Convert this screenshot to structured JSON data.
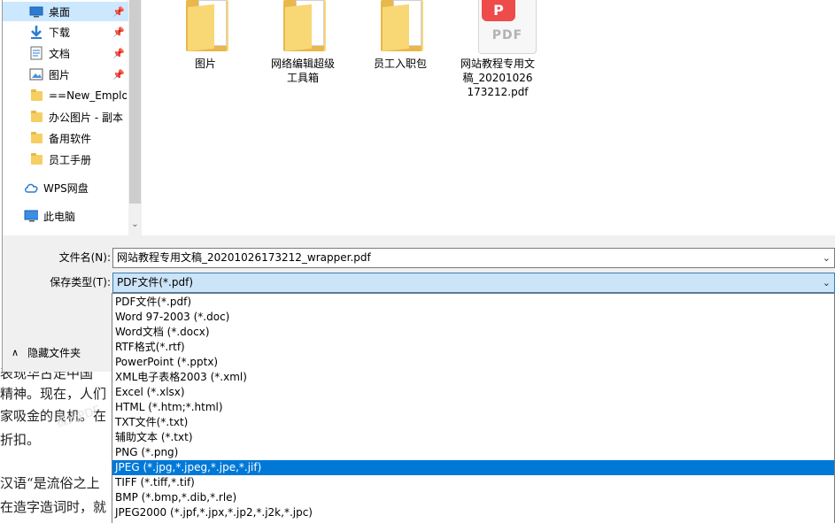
{
  "nav": {
    "items": [
      {
        "label": "桌面",
        "icon": "desktop-icon",
        "pinned": true,
        "selected": true
      },
      {
        "label": "下载",
        "icon": "download-icon",
        "pinned": true,
        "selected": false
      },
      {
        "label": "文档",
        "icon": "document-icon",
        "pinned": true,
        "selected": false
      },
      {
        "label": "图片",
        "icon": "picture-icon",
        "pinned": true,
        "selected": false
      },
      {
        "label": "==New_Emplo",
        "icon": "folder-icon",
        "pinned": false,
        "selected": false
      },
      {
        "label": "办公图片 - 副本",
        "icon": "folder-icon",
        "pinned": false,
        "selected": false
      },
      {
        "label": "备用软件",
        "icon": "folder-icon",
        "pinned": false,
        "selected": false
      },
      {
        "label": "员工手册",
        "icon": "folder-icon",
        "pinned": false,
        "selected": false
      }
    ],
    "wps_label": "WPS网盘",
    "pc_label": "此电脑"
  },
  "files": [
    {
      "name": "图片",
      "type": "folder"
    },
    {
      "name": "网络编辑超级工具箱",
      "type": "folder"
    },
    {
      "name": "员工入职包",
      "type": "folder"
    },
    {
      "name": "网站教程专用文稿_20201026173212.pdf",
      "type": "pdf",
      "badge_text": "PDF"
    }
  ],
  "form": {
    "filename_label": "文件名(N):",
    "filename_value": "网站教程专用文稿_20201026173212_wrapper.pdf",
    "type_label": "保存类型(T):",
    "type_value": "PDF文件(*.pdf)"
  },
  "hide_folders_label": "隐藏文件夹",
  "type_options": [
    "PDF文件(*.pdf)",
    "Word 97-2003 (*.doc)",
    "Word文档 (*.docx)",
    "RTF格式(*.rtf)",
    "PowerPoint (*.pptx)",
    "XML电子表格2003 (*.xml)",
    "Excel (*.xlsx)",
    "HTML (*.htm;*.html)",
    "TXT文件(*.txt)",
    "辅助文本 (*.txt)",
    "PNG (*.png)",
    "JPEG (*.jpg,*.jpeg,*.jpe,*.jif)",
    "TIFF (*.tiff,*.tif)",
    "BMP (*.bmp,*.dib,*.rle)",
    "JPEG2000 (*.jpf,*.jpx,*.jp2,*.j2k,*.jpc)"
  ],
  "highlighted_option_index": 11,
  "background_doc_lines": [
    "表现华古走中国",
    "精神。现在，人们",
    "家吸金的良机。在",
    "折扣。",
    "",
    "汉语“是流俗之上",
    "在造字造词时，就"
  ],
  "colors": {
    "accent": "#0078d7",
    "selection": "#cce8ff",
    "folder": "#f8d775",
    "pdf_red": "#ee4b4b"
  }
}
